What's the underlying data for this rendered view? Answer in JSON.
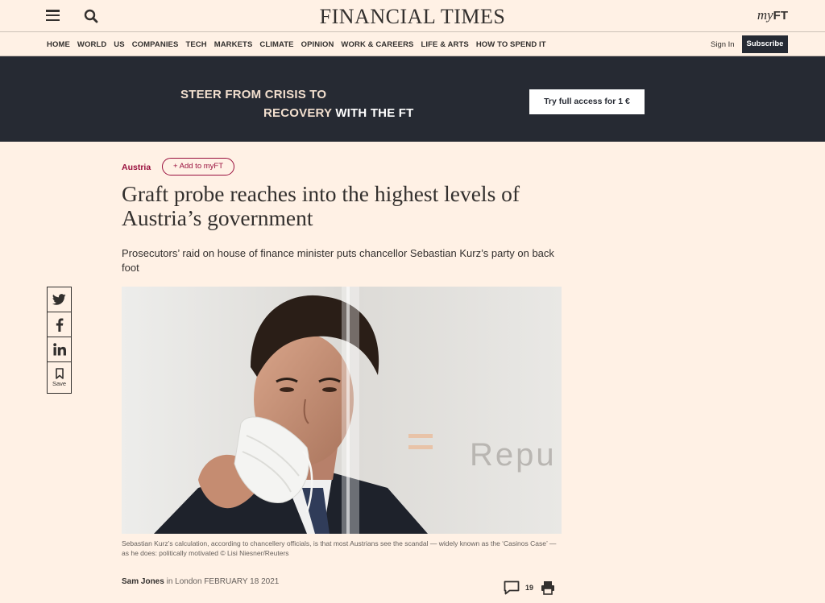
{
  "header": {
    "logo": "FINANCIAL TIMES",
    "myft_prefix": "my",
    "myft_suffix": "FT"
  },
  "nav": {
    "items": [
      "HOME",
      "WORLD",
      "US",
      "COMPANIES",
      "TECH",
      "MARKETS",
      "CLIMATE",
      "OPINION",
      "WORK & CAREERS",
      "LIFE & ARTS",
      "HOW TO SPEND IT"
    ],
    "sign_in": "Sign In",
    "subscribe": "Subscribe"
  },
  "banner": {
    "line1": "STEER FROM CRISIS TO",
    "line2_a": "RECOVERY ",
    "line2_b": "WITH THE FT",
    "cta": "Try full access for 1 €"
  },
  "article": {
    "topic": "Austria",
    "add_to_myft": "Add to myFT",
    "headline": "Graft probe reaches into the highest levels of Austria’s government",
    "standfirst": "Prosecutors’ raid on house of finance minister puts chancellor Sebastian Kurz’s party on back foot",
    "image_text": "Repu",
    "caption": "Sebastian Kurz’s calculation, according to chancellery officials, is that most Austrians see the scandal — widely known as the ‘Casinos Case’ — as he does: politically motivated © Lisi Niesner/Reuters",
    "author": "Sam Jones",
    "byline_in": " in London ",
    "date": "FEBRUARY 18 2021",
    "comment_count": "19"
  },
  "share": {
    "save_label": "Save"
  },
  "colors": {
    "background": "#fff1e5",
    "banner": "#262a33",
    "topic": "#990f3d",
    "text": "#33302e"
  }
}
